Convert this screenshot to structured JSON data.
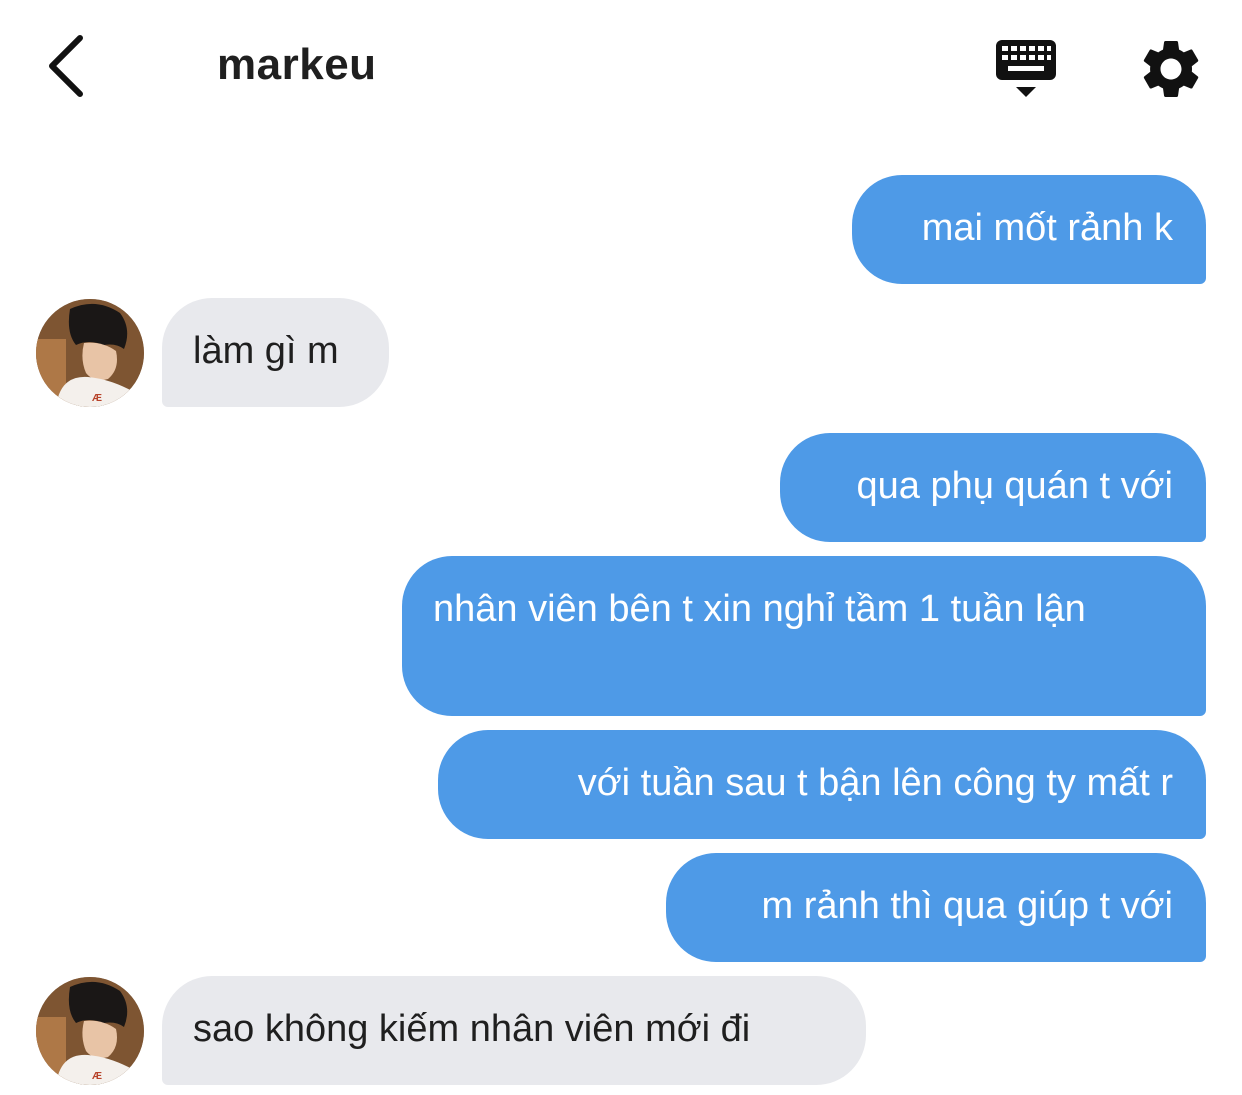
{
  "header": {
    "back_icon": "chevron-left-icon",
    "title": "markeu",
    "keyboard_icon": "keyboard-icon",
    "settings_icon": "gear-icon"
  },
  "colors": {
    "outgoing_bubble": "#4e9ae7",
    "incoming_bubble": "#e8e9ed",
    "title_text": "#1f1f1f"
  },
  "messages": [
    {
      "direction": "outgoing",
      "text": "mai mốt rảnh k"
    },
    {
      "direction": "incoming",
      "text": "làm gì m"
    },
    {
      "direction": "outgoing",
      "text": "qua phụ quán t với"
    },
    {
      "direction": "outgoing",
      "text": "nhân viên bên t xin nghỉ tầm 1 tuần lận"
    },
    {
      "direction": "outgoing",
      "text": "với tuần sau t bận lên công ty mất r"
    },
    {
      "direction": "outgoing",
      "text": "m rảnh thì qua giúp t với"
    },
    {
      "direction": "incoming",
      "text": "sao không kiếm nhân viên mới đi"
    }
  ]
}
